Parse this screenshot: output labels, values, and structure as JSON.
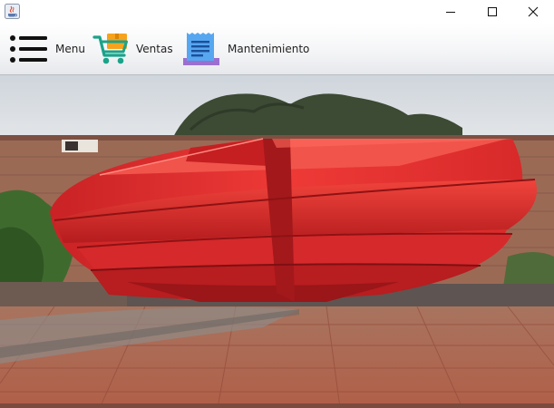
{
  "window": {
    "app_icon": "java-cup-icon",
    "controls": [
      "minimize-icon",
      "maximize-icon",
      "close-icon"
    ]
  },
  "toolbar": {
    "items": [
      {
        "label": "Menu",
        "icon": "hamburger-list-icon"
      },
      {
        "label": "Ventas",
        "icon": "shopping-cart-icon"
      },
      {
        "label": "Mantenimiento",
        "icon": "document-icon"
      }
    ]
  },
  "content": {
    "image": "red-sculpture-plaza-photo"
  }
}
